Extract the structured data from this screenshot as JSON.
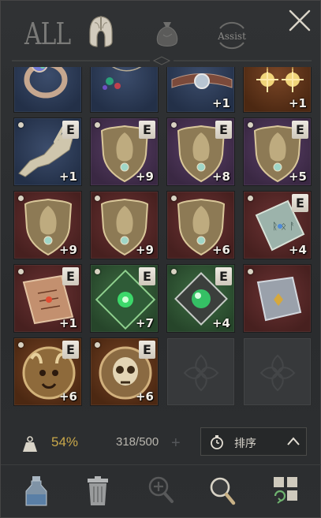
{
  "header": {
    "tab_all_label": "ALL",
    "tab_armor_icon": "helmet-icon",
    "tab_loot_icon": "pouch-icon",
    "assist_label": "Assist",
    "close_icon": "close-icon"
  },
  "inventory": {
    "rows": [
      [
        {
          "icon": "ring-icon",
          "bg": "blue",
          "upgrade": "",
          "equipped": true
        },
        {
          "icon": "amulet-icon",
          "bg": "blue",
          "upgrade": "",
          "equipped": true
        },
        {
          "icon": "belt-icon",
          "bg": "blue",
          "upgrade": "+1",
          "equipped": true
        },
        {
          "icon": "earrings-icon",
          "bg": "orange",
          "upgrade": "+1",
          "equipped": true
        }
      ],
      [
        {
          "icon": "dragon-skull-icon",
          "bg": "blue",
          "upgrade": "+1",
          "equipped": true
        },
        {
          "icon": "crest-shield-icon",
          "bg": "purple",
          "upgrade": "+9",
          "equipped": true
        },
        {
          "icon": "crest-shield-icon",
          "bg": "purple",
          "upgrade": "+8",
          "equipped": true
        },
        {
          "icon": "crest-shield-icon",
          "bg": "purple",
          "upgrade": "+5",
          "equipped": true
        }
      ],
      [
        {
          "icon": "crest-shield-icon",
          "bg": "red",
          "upgrade": "+9",
          "equipped": false
        },
        {
          "icon": "crest-shield-icon",
          "bg": "red",
          "upgrade": "+9",
          "equipped": false
        },
        {
          "icon": "crest-shield-icon",
          "bg": "red",
          "upgrade": "+6",
          "equipped": false
        },
        {
          "icon": "rune-tablet-icon",
          "bg": "red",
          "upgrade": "+4",
          "equipped": true
        }
      ],
      [
        {
          "icon": "spellbook-icon",
          "bg": "red",
          "upgrade": "+1",
          "equipped": true
        },
        {
          "icon": "emerald-sigil-icon",
          "bg": "green",
          "upgrade": "+7",
          "equipped": true
        },
        {
          "icon": "emerald-orb-icon",
          "bg": "green",
          "upgrade": "+4",
          "equipped": true
        },
        {
          "icon": "stone-tablet-icon",
          "bg": "red",
          "upgrade": "",
          "equipped": false
        }
      ],
      [
        {
          "icon": "beast-medallion-icon",
          "bg": "orange",
          "upgrade": "+6",
          "equipped": true
        },
        {
          "icon": "skull-medallion-icon",
          "bg": "orange",
          "upgrade": "+6",
          "equipped": true
        },
        {
          "icon": "empty-slot-icon",
          "bg": "empty",
          "upgrade": "",
          "equipped": false
        },
        {
          "icon": "empty-slot-icon",
          "bg": "empty",
          "upgrade": "",
          "equipped": false
        }
      ]
    ],
    "equipped_badge": "E"
  },
  "status": {
    "weight_icon": "weight-icon",
    "weight_percent": "54%",
    "capacity": "318/500",
    "expand_icon": "plus-icon",
    "sort_label": "排序",
    "sort_icon": "stopwatch-icon"
  },
  "toolbar": {
    "tools": [
      "potion-icon",
      "trash-bin-icon",
      "zoom-in-icon",
      "search-icon",
      "grid-auto-icon"
    ]
  },
  "colors": {
    "weight_accent": "#c9a84a",
    "badge_bg": "#e6e1d7"
  }
}
